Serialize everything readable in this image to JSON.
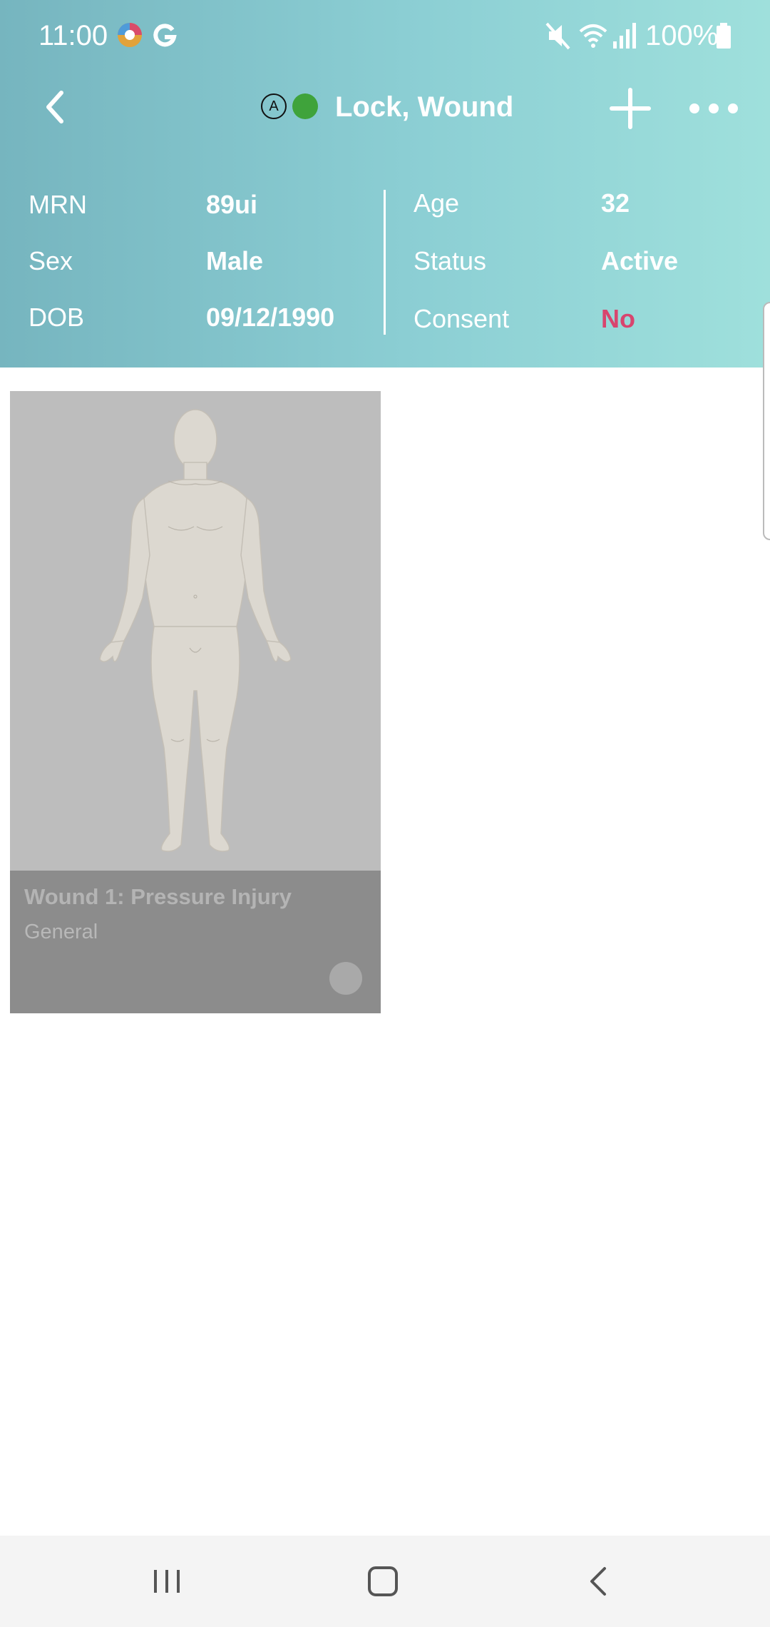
{
  "status_bar": {
    "time": "11:00",
    "battery": "100%",
    "icons": [
      "browser-app-icon",
      "google-icon",
      "mute-icon",
      "wifi-icon",
      "signal-icon",
      "battery-icon"
    ]
  },
  "nav": {
    "badge_letter": "A",
    "online_color": "#3fa33b",
    "title": "Lock, Wound",
    "icons": [
      "back-icon",
      "add-icon",
      "more-icon"
    ]
  },
  "patient_info": {
    "mrn_label": "MRN",
    "mrn_value": "89ui",
    "sex_label": "Sex",
    "sex_value": "Male",
    "dob_label": "DOB",
    "dob_value": "09/12/1990",
    "age_label": "Age",
    "age_value": "32",
    "status_label": "Status",
    "status_value": "Active",
    "consent_label": "Consent",
    "consent_value": "No",
    "consent_color": "#d8456e"
  },
  "wounds": [
    {
      "title": "Wound 1: Pressure Injury",
      "subtitle": "General",
      "image": "body-front-figure"
    }
  ],
  "android_nav": {
    "icons": [
      "recent-apps-icon",
      "home-icon",
      "back-nav-icon"
    ]
  },
  "colors": {
    "header_start": "#76b5bf",
    "header_end": "#9fe0dc",
    "card_bg": "#bdbdbd",
    "card_footer": "#8c8c8c"
  }
}
